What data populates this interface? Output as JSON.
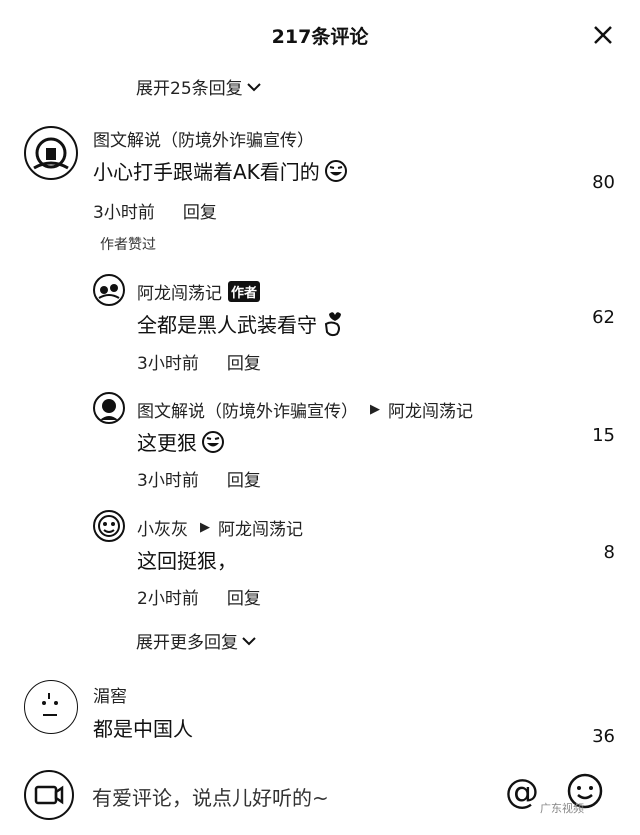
{
  "header": {
    "title": "217条评论"
  },
  "thread": {
    "expand_top": "展开25条回复",
    "expand_more": "展开更多回复",
    "main_comment": {
      "author": "图文解说（防境外诈骗宣传）",
      "text": "小心打手跟端着AK看门的",
      "time": "3小时前",
      "reply": "回复",
      "likes": "80",
      "author_liked": "作者赞过"
    },
    "replies": [
      {
        "author": "阿龙闯荡记",
        "badge": "作者",
        "text": "全都是黑人武装看守",
        "time": "3小时前",
        "reply": "回复",
        "likes": "62"
      },
      {
        "author": "图文解说（防境外诈骗宣传）",
        "to": "阿龙闯荡记",
        "text": "这更狠",
        "time": "3小时前",
        "reply": "回复",
        "likes": "15"
      },
      {
        "author": "小灰灰",
        "to": "阿龙闯荡记",
        "text": "这回挺狠，",
        "time": "2小时前",
        "reply": "回复",
        "likes": "8"
      }
    ]
  },
  "comment2": {
    "author": "湄窖",
    "text": "都是中国人",
    "likes": "36"
  },
  "input": {
    "placeholder": "有爱评论，说点儿好听的~",
    "at": "@"
  },
  "watermark": "广东视频"
}
